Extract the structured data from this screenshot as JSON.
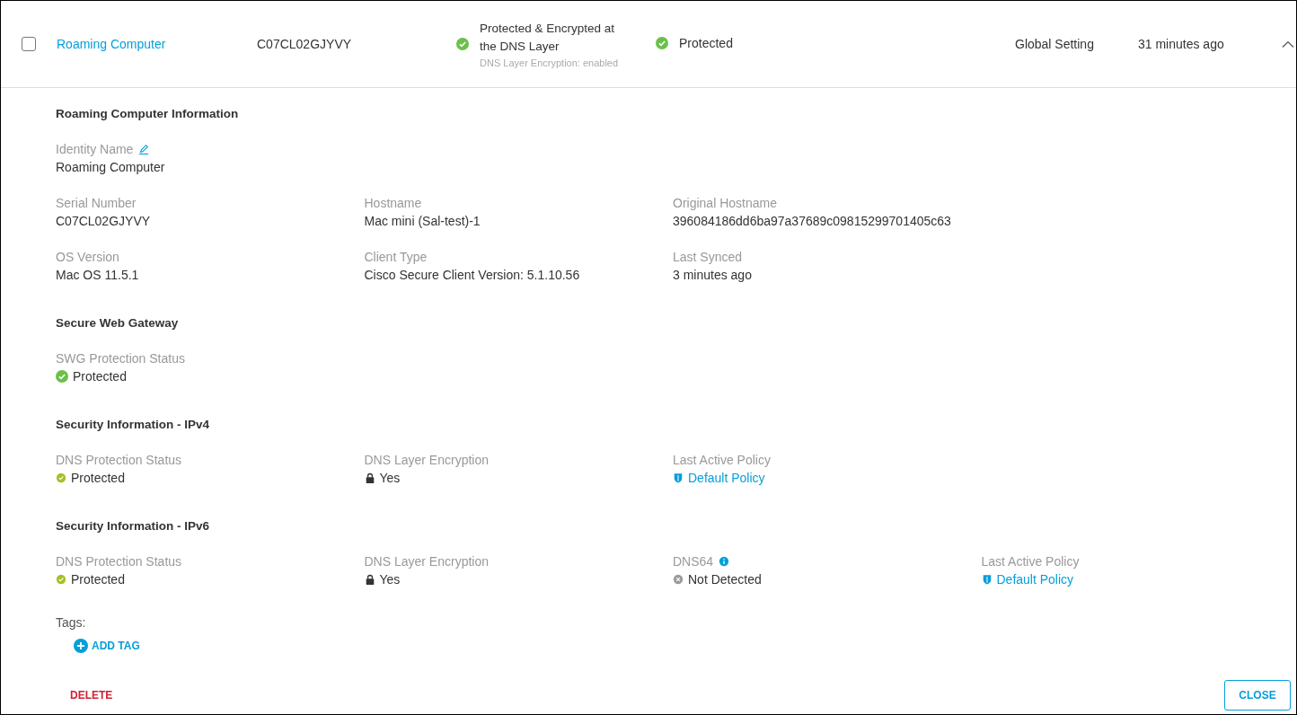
{
  "summary": {
    "checked": false,
    "expanded": true,
    "name": "Roaming Computer",
    "serial": "C07CL02GJYVY",
    "encryption_status": {
      "kind": "protected",
      "lines": [
        "Protected & Encrypted at",
        "the DNS Layer"
      ],
      "note": "DNS Layer Encryption: enabled"
    },
    "protection_status": {
      "kind": "protected",
      "text": "Protected"
    },
    "policy": "Global Setting",
    "last_seen": "31 minutes ago"
  },
  "sections": [
    {
      "title": "Roaming Computer Information",
      "rows": [
        [
          {
            "label": "Identity Name",
            "editable": true,
            "kind": "plain",
            "value": "Roaming Computer"
          }
        ],
        [
          {
            "label": "Serial Number",
            "kind": "plain",
            "value": "C07CL02GJYVY"
          },
          {
            "label": "Hostname",
            "kind": "plain",
            "value": "Mac mini (Sal-test)-1"
          },
          {
            "label": "Original Hostname",
            "kind": "plain",
            "value": "396084186dd6ba97a37689c09815299701405c63"
          }
        ],
        [
          {
            "label": "OS Version",
            "kind": "plain",
            "value": "Mac OS 11.5.1"
          },
          {
            "label": "Client Type",
            "kind": "plain",
            "value": "Cisco Secure Client Version: 5.1.10.56"
          },
          {
            "label": "Last Synced",
            "kind": "plain",
            "value": "3 minutes ago"
          }
        ]
      ]
    },
    {
      "title": "Secure Web Gateway",
      "rows": [
        [
          {
            "label": "SWG Protection Status",
            "kind": "protected",
            "value": "Protected"
          }
        ]
      ]
    },
    {
      "title": "Security Information - IPv4",
      "rows": [
        [
          {
            "label": "DNS Protection Status",
            "kind": "dns-protected",
            "value": "Protected"
          },
          {
            "label": "DNS Layer Encryption",
            "kind": "encrypted",
            "value": "Yes"
          },
          {
            "label": "Last Active Policy",
            "kind": "policy",
            "value": "Default Policy"
          }
        ]
      ]
    },
    {
      "title": "Security Information - IPv6",
      "rows": [
        [
          {
            "label": "DNS Protection Status",
            "kind": "dns-protected",
            "value": "Protected"
          },
          {
            "label": "DNS Layer Encryption",
            "kind": "encrypted",
            "value": "Yes"
          },
          {
            "label": "DNS64",
            "has_info": true,
            "kind": "not-detected",
            "value": "Not Detected"
          },
          {
            "label": "Last Active Policy",
            "kind": "policy",
            "value": "Default Policy"
          }
        ]
      ]
    }
  ],
  "tags": {
    "label": "Tags:",
    "add_button": "ADD TAG"
  },
  "footer": {
    "delete_button": "DELETE",
    "close_button": "CLOSE"
  }
}
